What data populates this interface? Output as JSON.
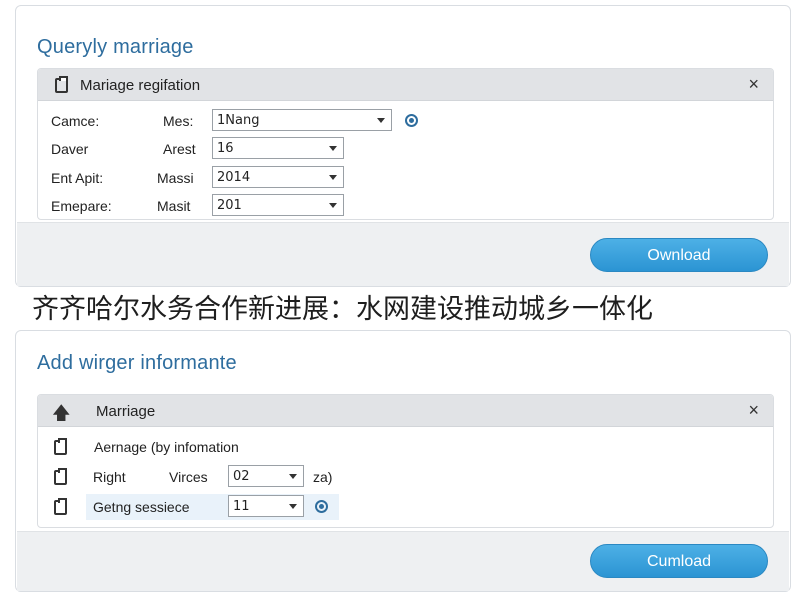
{
  "card1": {
    "title": "Queryly marriage",
    "panel": {
      "title": "Mariage regifation",
      "icon": "clipboard-icon",
      "close": "×",
      "rows": [
        {
          "label": "Camce:",
          "sublabel": "Mes:",
          "value": "1Nang"
        },
        {
          "label": "Daver",
          "sublabel": "Arest",
          "value": "16"
        },
        {
          "label": "Ent Apit:",
          "sublabel": "Massi",
          "value": "2014"
        },
        {
          "label": "Emepare:",
          "sublabel": "Masit",
          "value": "201"
        }
      ]
    },
    "button": "Ownload"
  },
  "headline": "齐齐哈尔水务合作新进展：水网建设推动城乡一体化",
  "card2": {
    "title": "Add wirger informante",
    "panel": {
      "title": "Marriage",
      "icon": "arrow-up-icon",
      "close": "×",
      "rows": [
        {
          "label": "Aernage (by infomation"
        },
        {
          "label": "Right",
          "sublabel": "Virces",
          "value": "02",
          "suffix": "za)"
        },
        {
          "label": "Getng sessiece",
          "value": "11"
        }
      ]
    },
    "button": "Cumload"
  },
  "colors": {
    "accent": "#2e6d9e",
    "button": "#2b94d3",
    "panel_header": "#e1e3e6"
  }
}
